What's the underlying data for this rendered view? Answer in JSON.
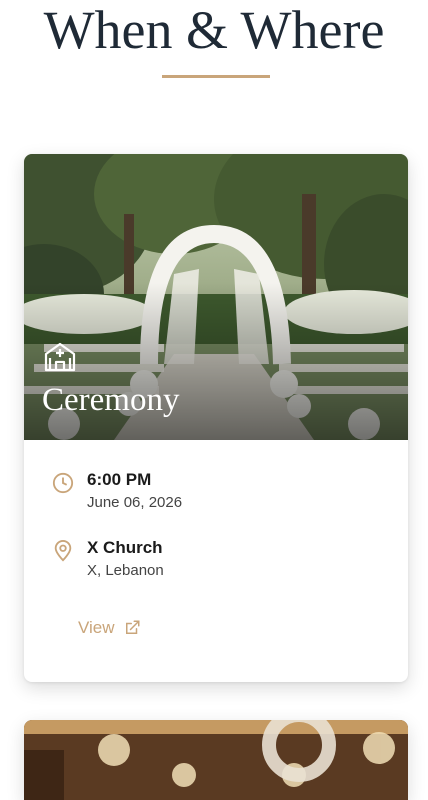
{
  "section": {
    "title": "When & Where"
  },
  "ceremony": {
    "title": "Ceremony",
    "time": "6:00 PM",
    "date": "June 06, 2026",
    "venue": "X Church",
    "location": "X, Lebanon",
    "view_label": "View"
  },
  "icons": {
    "hero": "church-icon",
    "time": "clock-icon",
    "place": "map-pin-icon",
    "link": "external-link-icon"
  },
  "colors": {
    "accent": "#c9a57a",
    "title": "#1f2a36"
  }
}
